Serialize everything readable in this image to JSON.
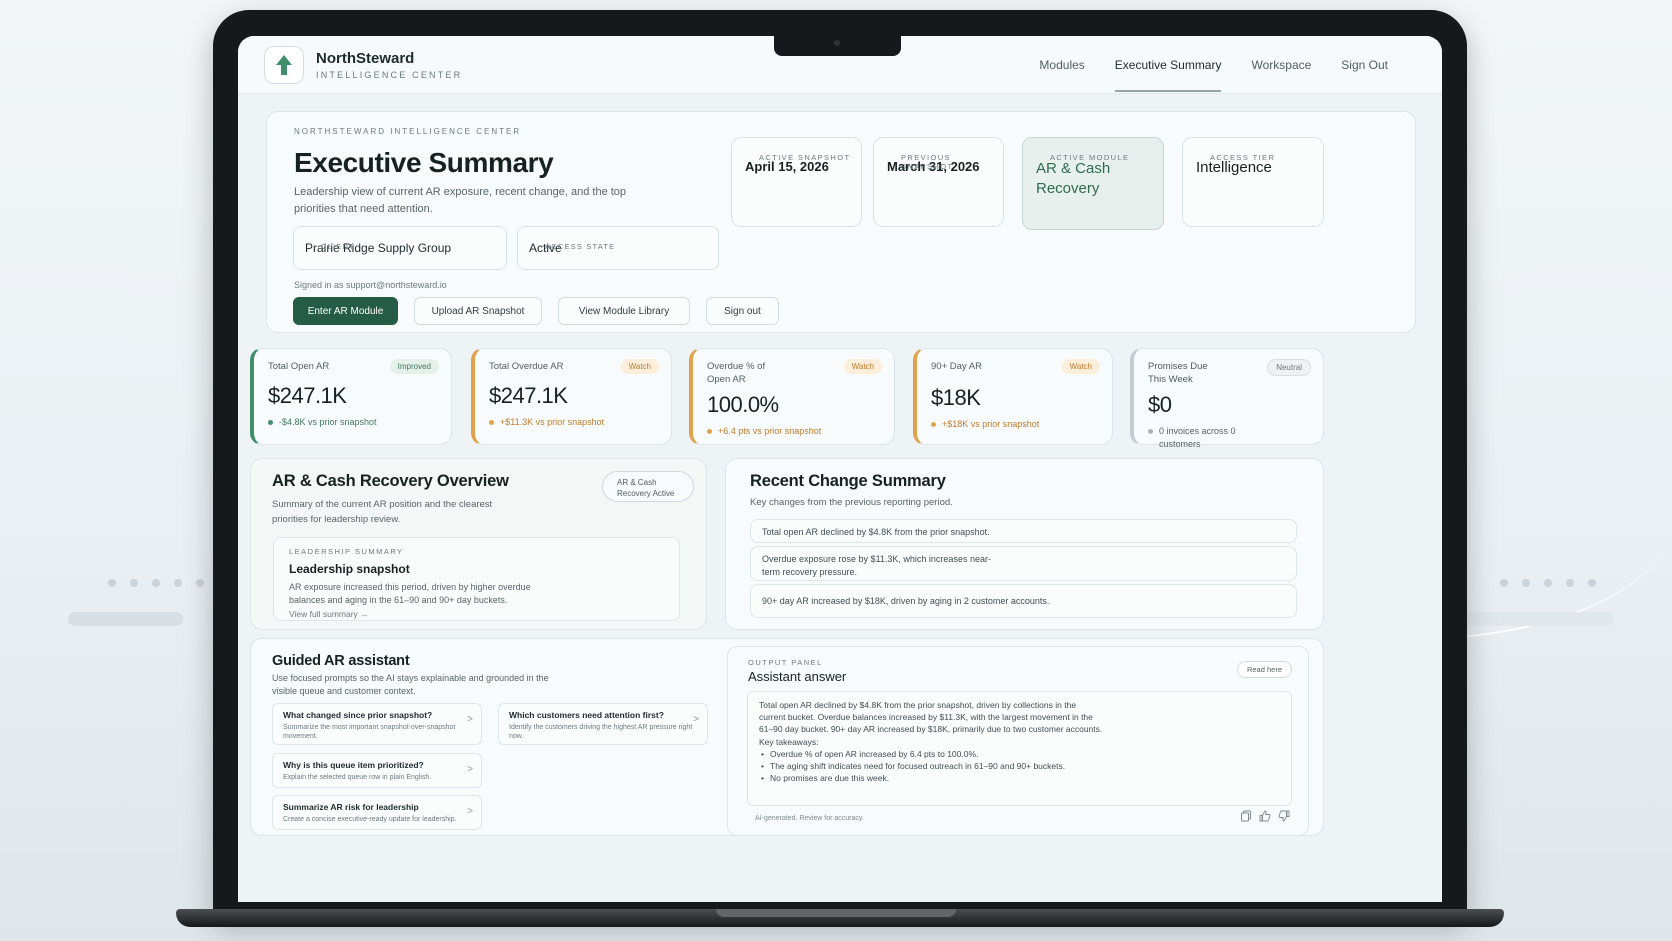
{
  "nav": {
    "brand_name": "NorthSteward",
    "brand_sub": "INTELLIGENCE CENTER",
    "links": [
      "Modules",
      "Executive Summary",
      "Workspace",
      "Sign Out"
    ]
  },
  "hero": {
    "eyebrow": "NORTHSTEWARD INTELLIGENCE CENTER",
    "title": "Executive Summary",
    "description": "Leadership view of current AR exposure, recent change, and the top priorities that need attention.",
    "client_label": "CLIENT",
    "client_value": "Prairie Ridge Supply Group",
    "access_label": "ACCESS STATE",
    "access_value": "Active",
    "signed_in": "Signed in as support@northsteward.io",
    "buttons": [
      "Enter AR Module",
      "Upload AR Snapshot",
      "View Module Library",
      "Sign out"
    ],
    "snapshots": [
      {
        "label": "ACTIVE SNAPSHOT",
        "value": "April 15, 2026"
      },
      {
        "label": "PREVIOUS SNAPSHOT",
        "value": "March 31, 2026"
      },
      {
        "label": "ACTIVE MODULE",
        "value": "AR & Cash Recovery"
      },
      {
        "label": "ACCESS TIER",
        "value": "Intelligence"
      }
    ]
  },
  "kpis": [
    {
      "label": "Total Open AR",
      "badge": "Improved",
      "value": "$247.1K",
      "delta": "-$4.8K vs prior snapshot",
      "status": "improved"
    },
    {
      "label": "Total Overdue AR",
      "badge": "Watch",
      "value": "$247.1K",
      "delta": "+$11.3K vs prior snapshot",
      "status": "watch"
    },
    {
      "label": "Overdue % of Open AR",
      "badge": "Watch",
      "value": "100.0%",
      "delta": "+6.4 pts vs prior snapshot",
      "status": "watch"
    },
    {
      "label": "90+ Day AR",
      "badge": "Watch",
      "value": "$18K",
      "delta": "+$18K vs prior snapshot",
      "status": "watch"
    },
    {
      "label": "Promises Due This Week",
      "badge": "Neutral",
      "value": "$0",
      "delta": "0 invoices across 0 customers",
      "status": "neutral"
    }
  ],
  "colors": {
    "improved": "#3f8f6a",
    "watch": "#e0a24a",
    "neutral": "#a9b4b8",
    "primary": "#245c45"
  },
  "overview": {
    "title": "AR & Cash Recovery Overview",
    "description": "Summary of the current AR position and the clearest priorities for leadership review.",
    "badge": "AR & Cash Recovery Active",
    "lead_eyebrow": "LEADERSHIP SUMMARY",
    "lead_title": "Leadership snapshot",
    "lead_text": "AR exposure increased this period, driven by higher overdue balances and aging in the 61–90 and 90+ day buckets.",
    "lead_link": "View full summary →"
  },
  "recent": {
    "title": "Recent Change Summary",
    "description": "Key changes from the previous reporting period.",
    "items": [
      "Total open AR declined by $4.8K from the prior snapshot.",
      "Overdue exposure rose by $11.3K, which increases near-term recovery pressure.",
      "90+ day AR increased by $18K, driven by aging in 2 customer accounts."
    ]
  },
  "guided": {
    "title": "Guided AR assistant",
    "description": "Use focused prompts so the AI stays explainable and grounded in the visible queue and customer context.",
    "prompts": [
      {
        "title": "What changed since prior snapshot?",
        "sub": "Summarize the most important snapshot-over-snapshot movement."
      },
      {
        "title": "Which customers need attention first?",
        "sub": "Identify the customers driving the highest AR pressure right now."
      },
      {
        "title": "Why is this queue item prioritized?",
        "sub": "Explain the selected queue row in plain English."
      },
      {
        "title": "Summarize AR risk for leadership",
        "sub": "Create a concise executive-ready update for leadership."
      }
    ],
    "chevron": ">"
  },
  "output": {
    "eyebrow": "OUTPUT PANEL",
    "title": "Assistant answer",
    "read_label": "Read here",
    "answer": "Total open AR declined by $4.8K from the prior snapshot, driven by collections in the current bucket. Overdue balances increased by $11.3K, with the largest movement in the 61–90 day bucket. 90+ day AR increased by $18K, primarily due to two customer accounts.",
    "takeaways_label": "Key takeaways:",
    "takeaways": [
      "Overdue % of open AR increased by 6.4 pts to 100.0%.",
      "The aging shift indicates need for focused outreach in 61–90 and 90+ buckets.",
      "No promises are due this week."
    ],
    "note": "AI-generated. Review for accuracy.",
    "icons": [
      "copy-icon",
      "thumbs-up-icon",
      "thumbs-down-icon"
    ]
  }
}
